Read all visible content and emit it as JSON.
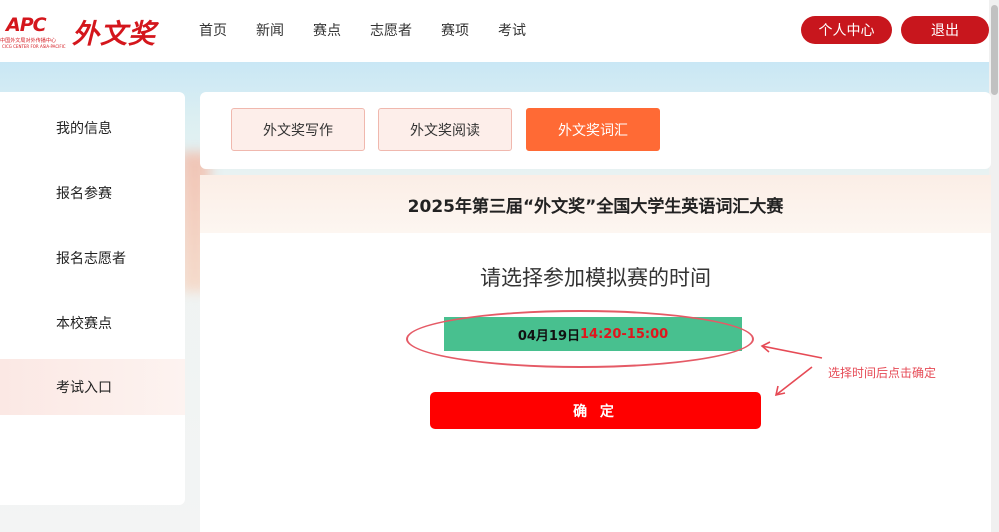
{
  "header": {
    "logo_apc": "APC",
    "logo_apc_sub": "中国外文局对外传播中心",
    "logo_apc_sub2": "CICG CENTER FOR ASIA-PACIFIC",
    "logo_wwj": "外文奖",
    "nav": [
      "首页",
      "新闻",
      "赛点",
      "志愿者",
      "赛项",
      "考试"
    ],
    "btn_center": "个人中心",
    "btn_logout": "退出"
  },
  "sidebar": {
    "items": [
      {
        "label": "我的信息"
      },
      {
        "label": "报名参赛"
      },
      {
        "label": "报名志愿者"
      },
      {
        "label": "本校赛点"
      },
      {
        "label": "考试入口"
      }
    ]
  },
  "tabs": [
    {
      "label": "外文奖写作"
    },
    {
      "label": "外文奖阅读"
    },
    {
      "label": "外文奖词汇"
    }
  ],
  "main": {
    "title": "2025年第三届“外文奖”全国大学生英语词汇大赛",
    "heading": "请选择参加模拟赛的时间",
    "time_date": "04月19日",
    "time_range": "14:20-15:00",
    "confirm": "确 定",
    "annotation": "选择时间后点击确定"
  },
  "colors": {
    "brand_red": "#c8161d",
    "tab_active": "#ff6a35",
    "time_green": "#48c08f",
    "confirm_red": "#ff0000",
    "annotation": "#e64a55"
  }
}
